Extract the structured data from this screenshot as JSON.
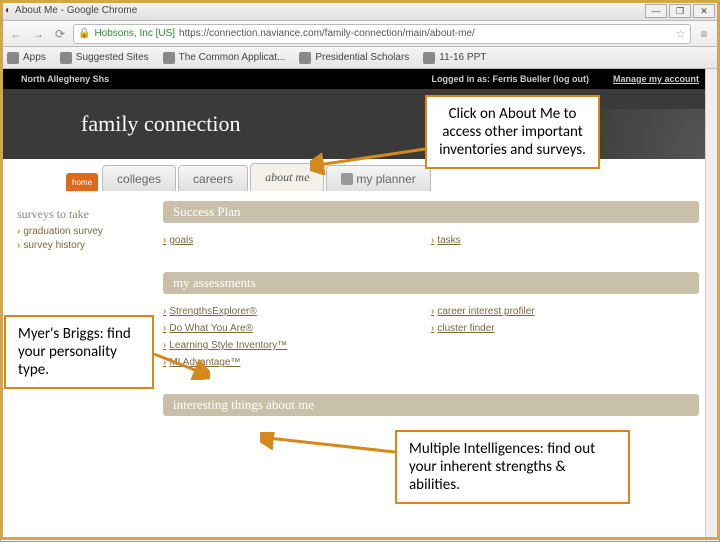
{
  "window": {
    "title": "About Me - Google Chrome"
  },
  "winbtns": [
    "—",
    "❐",
    "✕"
  ],
  "nav": {
    "back": "←",
    "fwd": "→",
    "reload": "⟳"
  },
  "url": {
    "host": "Hobsons, Inc [US]",
    "full": "https://connection.naviance.com/family-connection/main/about-me/"
  },
  "bookmarks": [
    "Apps",
    "Suggested Sites",
    "The Common Applicat...",
    "Presidential Scholars",
    "11-16 PPT"
  ],
  "blackbar": {
    "school": "North Allegheny Shs",
    "logged": "Logged in as: Ferris Bueller (log out)",
    "manage": "Manage my account"
  },
  "brand": "family connection",
  "hometab": "home",
  "tabs": [
    {
      "label": "colleges",
      "active": false
    },
    {
      "label": "careers",
      "active": false
    },
    {
      "label": "about me",
      "active": true
    },
    {
      "label": "my planner",
      "active": false,
      "icon": true
    }
  ],
  "sidebar": {
    "head": "surveys to take",
    "items": [
      "graduation survey",
      "survey history"
    ]
  },
  "sections": [
    {
      "title": "Success Plan",
      "left": [
        "goals"
      ],
      "right": [
        "tasks"
      ]
    },
    {
      "title": "my assessments",
      "left": [
        "StrengthsExplorer®",
        "Do What You Are®",
        "Learning Style Inventory™",
        "MI Advantage™"
      ],
      "right": [
        "career interest profiler",
        "cluster finder"
      ]
    },
    {
      "title": "interesting things about me",
      "left": [],
      "right": []
    }
  ],
  "callouts": {
    "c1": "Click on About Me to access other important inventories and surveys.",
    "c2": "Myer's Briggs: find your personality type.",
    "c3": "Multiple Intelligences: find out your inherent strengths & abilities."
  }
}
